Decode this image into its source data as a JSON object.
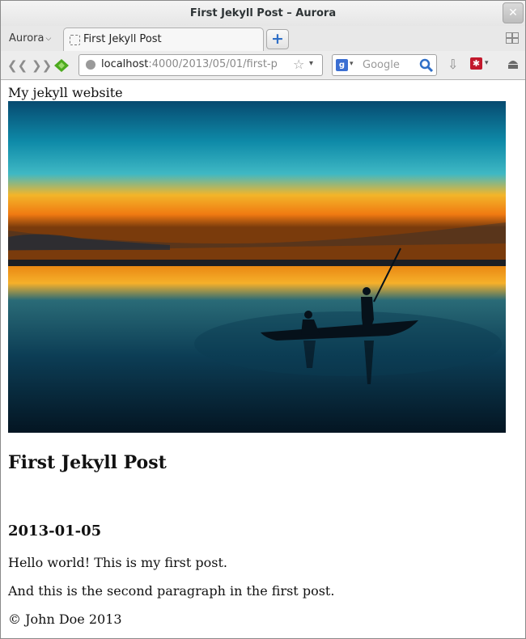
{
  "window": {
    "title": "First Jekyll Post – Aurora",
    "close_glyph": "✕"
  },
  "tabstrip": {
    "app_menu_label": "Aurora",
    "tab_label": "First Jekyll Post",
    "new_tab_glyph": "+"
  },
  "navbar": {
    "url_host": "localhost",
    "url_rest": ":4000/2013/05/01/first-p",
    "search_engine_glyph": "g",
    "search_placeholder": "Google",
    "back_icon": "back-arrow-icon",
    "forward_icon": "forward-arrow-icon"
  },
  "page": {
    "site_title": "My jekyll website",
    "hero_image": "sunset-lake-boat-silhouette",
    "post_title": "First Jekyll Post",
    "post_date": "2013-01-05",
    "paragraphs": [
      "Hello world! This is my first post.",
      "And this is the second paragraph in the first post."
    ],
    "footer": "© John Doe 2013"
  },
  "colors": {
    "accent_blue": "#2f6fc7",
    "nav_green": "#4caa1e",
    "addon_red": "#c2182c"
  }
}
